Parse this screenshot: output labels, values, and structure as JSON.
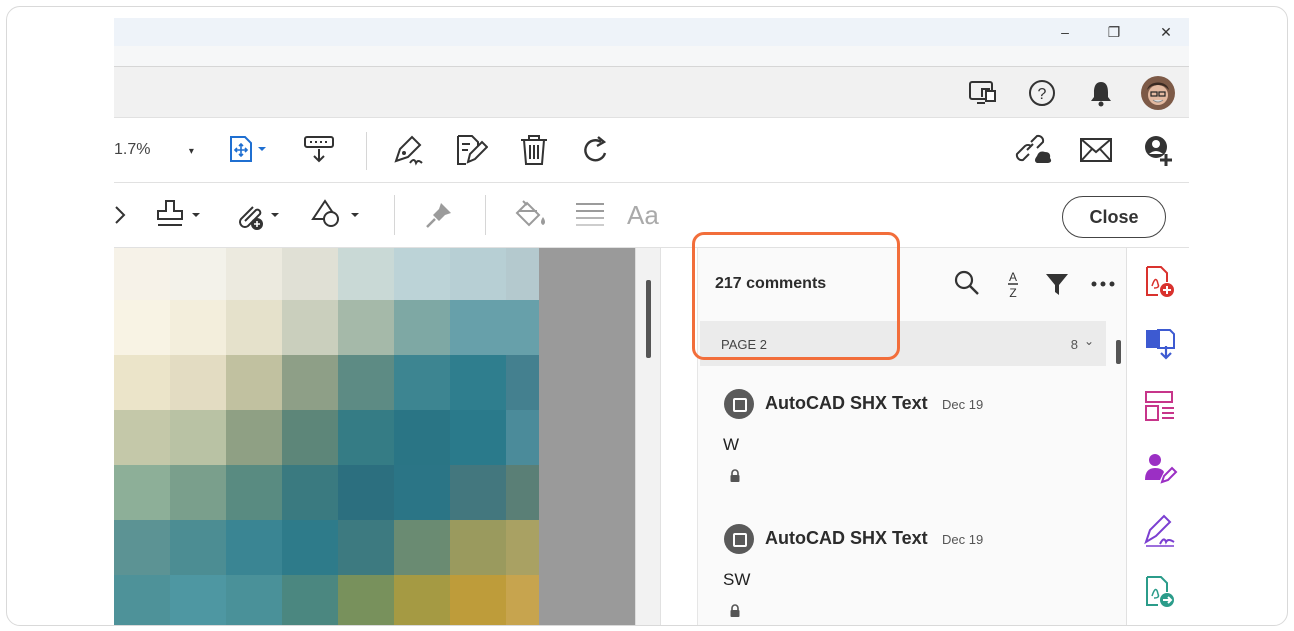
{
  "window": {
    "minimize_label": "–",
    "restore_label": "❐",
    "close_label": "✕"
  },
  "toolbar": {
    "zoom_value": "1.7%",
    "zoom_caret": "▾",
    "close_label": "Close",
    "font_label": "Aa"
  },
  "comments_panel": {
    "title": "217 comments",
    "page_group": {
      "label": "PAGE 2",
      "count": "8",
      "chevron": "⌄"
    },
    "comments": [
      {
        "author": "AutoCAD SHX Text",
        "date": "Dec 19",
        "text": "W"
      },
      {
        "author": "AutoCAD SHX Text",
        "date": "Dec 19",
        "text": "SW"
      }
    ]
  },
  "pixel_colors": [
    [
      "#f6f2e8",
      "#f3f2ea",
      "#eceadf",
      "#e0e0d5",
      "#c9d9d6",
      "#bcd3d7",
      "#b7cfd4",
      "#b4c9ce"
    ],
    [
      "#f8f3e4",
      "#f3eedc",
      "#e5e1cb",
      "#cacfbd",
      "#a5b9a9",
      "#7ea8a4",
      "#67a0aa",
      "#67a0aa"
    ],
    [
      "#ebe4c9",
      "#e3dcc2",
      "#c1c1a0",
      "#8e9f87",
      "#5d8b84",
      "#3d8591",
      "#2f7e8e",
      "#44808f"
    ],
    [
      "#c4c8a9",
      "#b9c2a4",
      "#8fa084",
      "#5d8679",
      "#357c85",
      "#2a7585",
      "#2a7a8b",
      "#4b8b9a"
    ],
    [
      "#8daf98",
      "#7a9f8c",
      "#598b81",
      "#3a7a80",
      "#2c6f7f",
      "#2b7586",
      "#43777e",
      "#5a7f76"
    ],
    [
      "#5c9394",
      "#4c8d93",
      "#3a8593",
      "#2e7b8a",
      "#3d7a80",
      "#6a8b72",
      "#9a9a5e",
      "#a9a163"
    ],
    [
      "#4e9299",
      "#4e97a2",
      "#4a9199",
      "#4b8780",
      "#78915c",
      "#a59a43",
      "#be9c3a",
      "#c7a44e"
    ]
  ]
}
